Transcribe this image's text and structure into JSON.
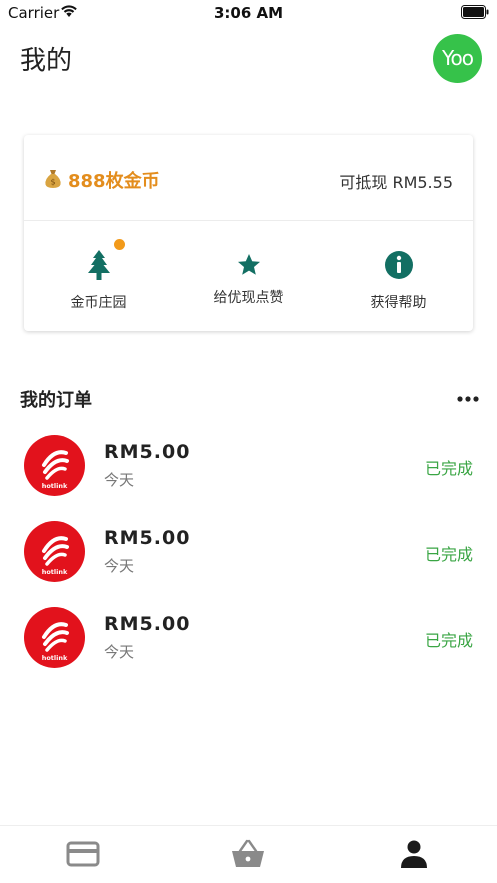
{
  "status_bar": {
    "carrier": "Carrier",
    "time": "3:06 AM"
  },
  "header": {
    "title": "我的",
    "logo_text": "Yoo"
  },
  "coins": {
    "balance_label": "888枚金币",
    "cash_value": "可抵现 RM5.55",
    "actions": [
      {
        "label": "金币庄园",
        "icon": "tree-icon",
        "has_notification": true
      },
      {
        "label": "给优现点赞",
        "icon": "star-icon",
        "has_notification": false
      },
      {
        "label": "获得帮助",
        "icon": "info-icon",
        "has_notification": false
      }
    ]
  },
  "orders": {
    "title": "我的订单",
    "items": [
      {
        "brand": "hotlink",
        "amount": "RM5.00",
        "date": "今天",
        "status": "已完成"
      },
      {
        "brand": "hotlink",
        "amount": "RM5.00",
        "date": "今天",
        "status": "已完成"
      },
      {
        "brand": "hotlink",
        "amount": "RM5.00",
        "date": "今天",
        "status": "已完成"
      }
    ]
  },
  "tab_bar": {
    "tabs": [
      {
        "icon": "card-icon",
        "active": false
      },
      {
        "icon": "basket-icon",
        "active": false
      },
      {
        "icon": "person-icon",
        "active": true
      }
    ]
  },
  "colors": {
    "brand_green": "#36c24a",
    "coin_orange": "#e38d1d",
    "teal_icon": "#136f63",
    "status_green": "#3aa544",
    "hotlink_red": "#e2121c"
  }
}
